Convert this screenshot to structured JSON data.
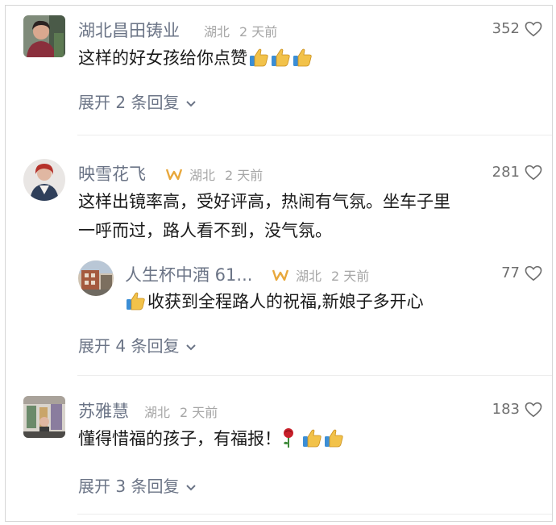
{
  "comments": [
    {
      "user": "湖北昌田铸业",
      "location": "湖北",
      "time": "2 天前",
      "likes": "352",
      "text": "这样的好女孩给你点赞",
      "emojis": [
        "thumbs-up",
        "thumbs-up",
        "thumbs-up"
      ],
      "expand": "展开 2 条回复"
    },
    {
      "user": "映雪花飞",
      "location": "湖北",
      "time": "2 天前",
      "likes": "281",
      "text_line1": "这样出镜率高，受好评高，热闹有气氛。坐车子里",
      "text_line2": "一呼而过，路人看不到，没气氛。",
      "reply": {
        "user": "人生杯中酒 61...",
        "location": "湖北",
        "time": "2 天前",
        "likes": "77",
        "text": "收获到全程路人的祝福,新娘子多开心"
      },
      "expand": "展开 4 条回复"
    },
    {
      "user": "苏雅慧",
      "location": "湖北",
      "time": "2 天前",
      "likes": "183",
      "text": "懂得惜福的孩子，有福报！",
      "emojis": [
        "rose",
        "thumbs-up",
        "thumbs-up"
      ],
      "expand": "展开 3 条回复"
    }
  ],
  "colors": {
    "username": "#6b7486",
    "meta": "#a6a6a6",
    "badge": "#e8a83c",
    "thumb": "#f2c24a"
  }
}
